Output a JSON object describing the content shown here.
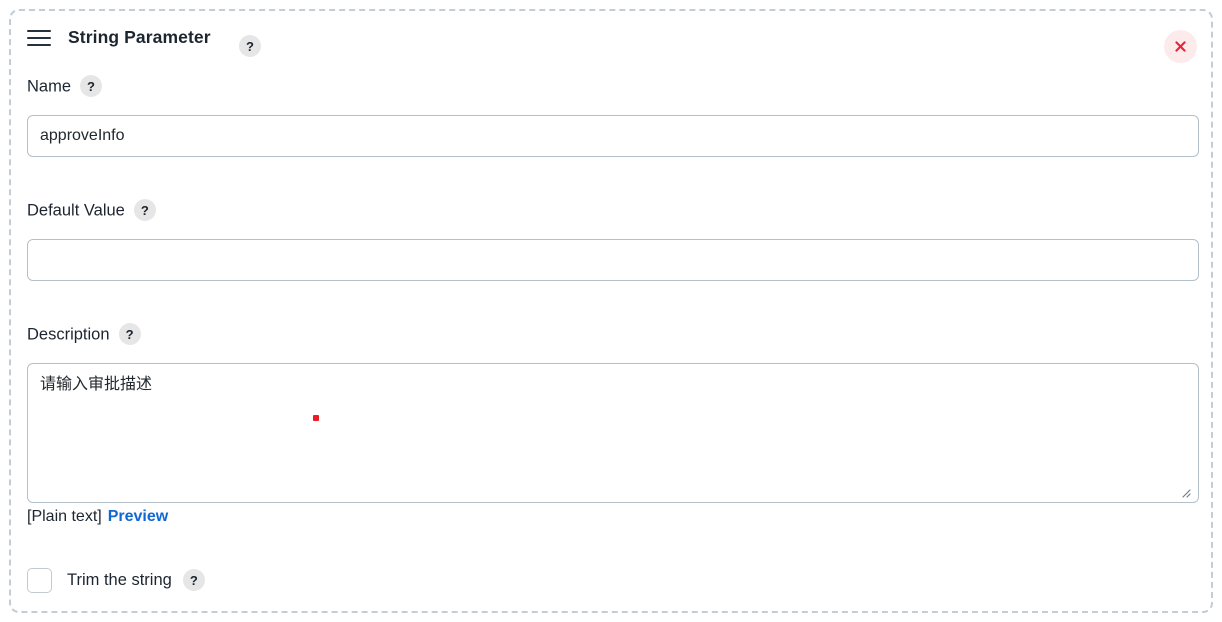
{
  "panel": {
    "title": "String Parameter",
    "drag_handle_icon": "hamburger-icon",
    "title_help_label": "?",
    "close_icon": "close-icon"
  },
  "fields": {
    "name": {
      "label": "Name",
      "help_label": "?",
      "value": "approveInfo",
      "placeholder": ""
    },
    "default_value": {
      "label": "Default Value",
      "help_label": "?",
      "value": "",
      "placeholder": ""
    },
    "description": {
      "label": "Description",
      "help_label": "?",
      "value": "请输入审批描述",
      "placeholder": "",
      "format_text": "[Plain text]",
      "preview_link": "Preview"
    },
    "trim": {
      "label": "Trim the string",
      "help_label": "?",
      "checked": false
    }
  },
  "colors": {
    "panel_border": "#c2cdd6",
    "input_border": "#b3c0c9",
    "link_blue": "#1068d4",
    "close_red": "#ed2233",
    "close_bg": "#fdebec",
    "help_badge_bg": "#e6e6e6",
    "text_primary": "#1d2630",
    "marker_red": "#ed1c24"
  }
}
